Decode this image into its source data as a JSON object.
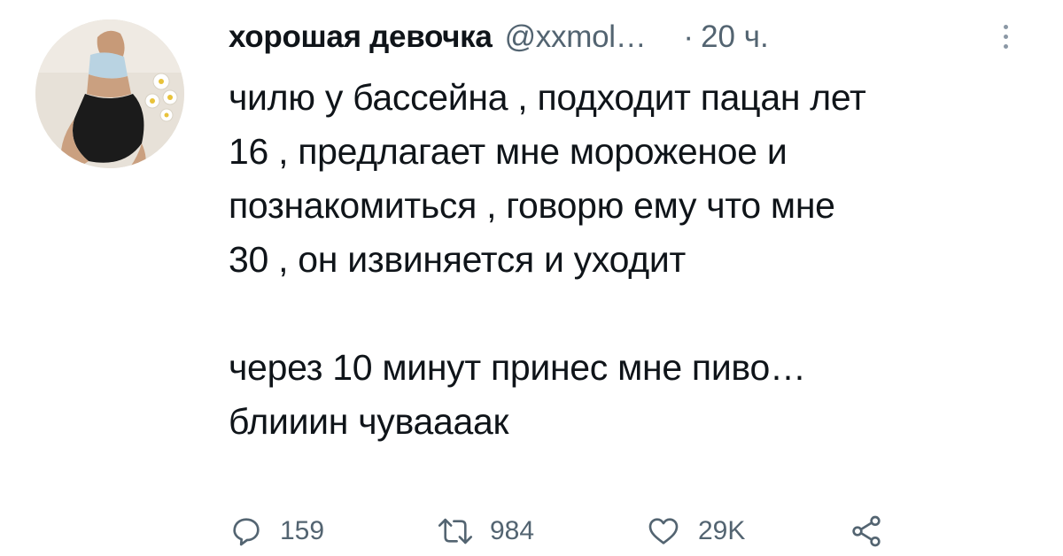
{
  "user": {
    "display_name": "хорошая девочка",
    "handle": "@xxmol…",
    "separator": "·",
    "time": "20 ч."
  },
  "tweet": {
    "text": "чилю у бассейна , подходит пацан лет\n16 , предлагает мне мороженое и\nпознакомиться , говорю ему что мне\n30 , он извиняется и уходит\n\nчерез 10 минут принес мне пиво…\nблииин чуваааак"
  },
  "actions": {
    "replies": "159",
    "retweets": "984",
    "likes": "29K"
  },
  "icons": {
    "reply": "reply-icon",
    "retweet": "retweet-icon",
    "like": "heart-icon",
    "share": "share-icon",
    "more": "more-icon"
  },
  "colors": {
    "text": "#0f1419",
    "secondary": "#536471",
    "background": "#ffffff"
  }
}
